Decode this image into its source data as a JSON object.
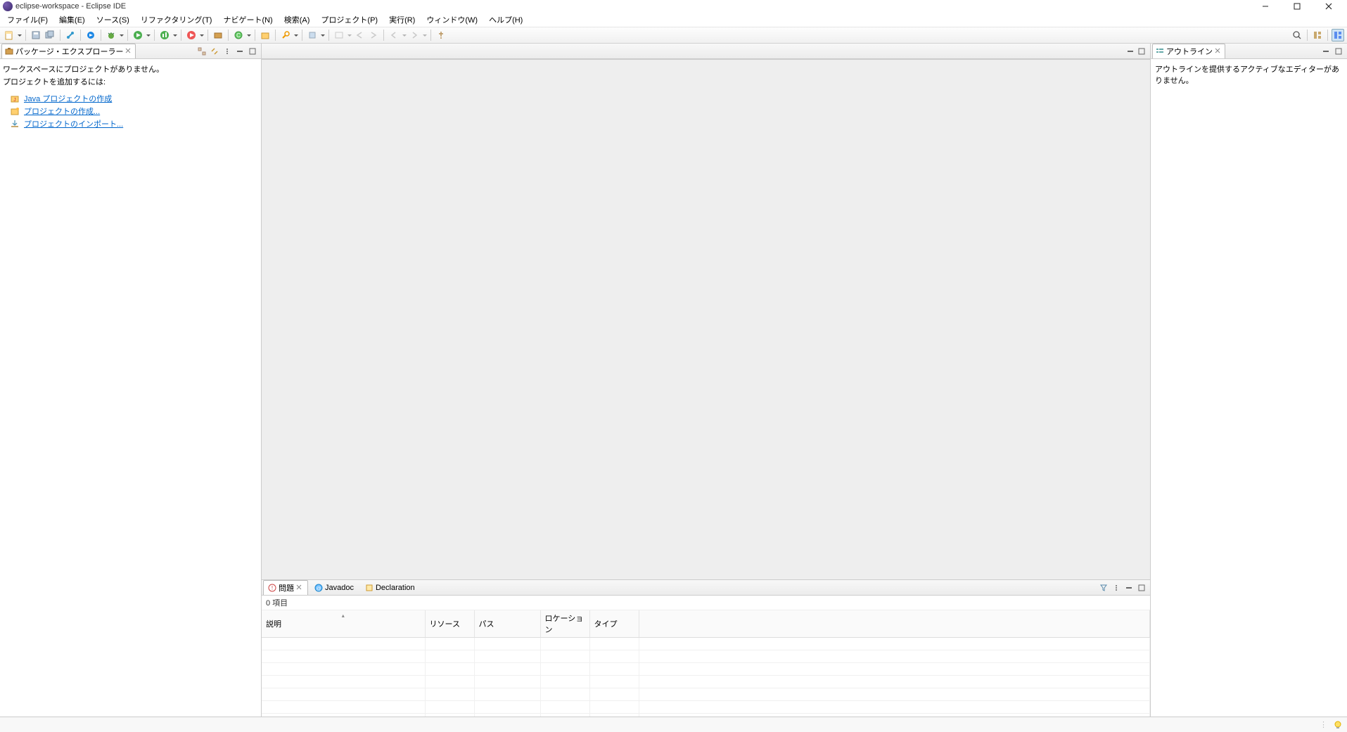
{
  "window": {
    "title": "eclipse-workspace - Eclipse IDE"
  },
  "menu": {
    "items": [
      {
        "label": "ファイル(F)"
      },
      {
        "label": "編集(E)"
      },
      {
        "label": "ソース(S)"
      },
      {
        "label": "リファクタリング(T)"
      },
      {
        "label": "ナビゲート(N)"
      },
      {
        "label": "検索(A)"
      },
      {
        "label": "プロジェクト(P)"
      },
      {
        "label": "実行(R)"
      },
      {
        "label": "ウィンドウ(W)"
      },
      {
        "label": "ヘルプ(H)"
      }
    ]
  },
  "package_explorer": {
    "title": "パッケージ・エクスプローラー",
    "msg1": "ワークスペースにプロジェクトがありません。",
    "msg2": "プロジェクトを追加するには:",
    "links": {
      "create_java": "Java プロジェクトの作成",
      "create_project": "プロジェクトの作成...",
      "import_project": "プロジェクトのインポート..."
    }
  },
  "outline": {
    "title": "アウトライン",
    "empty": "アウトラインを提供するアクティブなエディターがありません。"
  },
  "bottom": {
    "tabs": {
      "problems": "問題",
      "javadoc": "Javadoc",
      "declaration": "Declaration"
    },
    "count": "0 項目",
    "columns": {
      "description": "説明",
      "resource": "リソース",
      "path": "パス",
      "location": "ロケーション",
      "type": "タイプ"
    }
  }
}
